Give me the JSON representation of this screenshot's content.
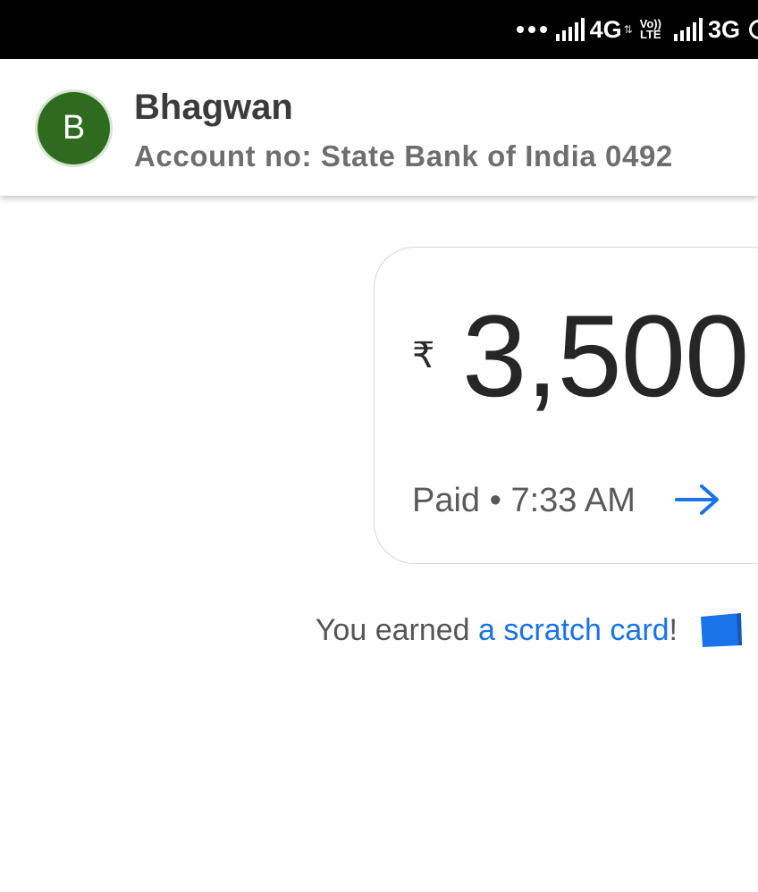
{
  "status_bar": {
    "network_1": "4G",
    "volte_top": "Vo))",
    "volte_bottom": "LTE",
    "network_2": "3G"
  },
  "header": {
    "avatar_initial": "B",
    "avatar_color": "#2e6b1f",
    "name": "Bhagwan",
    "account": "Account no: State Bank of India 0492"
  },
  "payment": {
    "currency_symbol": "₹",
    "amount": "3,500",
    "status": "Paid • 7:33 AM",
    "arrow_icon": "arrow-right-icon",
    "accent_color": "#1a73e8"
  },
  "reward": {
    "prefix": "You earned ",
    "link_text": "a scratch card",
    "suffix": "!",
    "icon": "scratch-card-icon"
  }
}
